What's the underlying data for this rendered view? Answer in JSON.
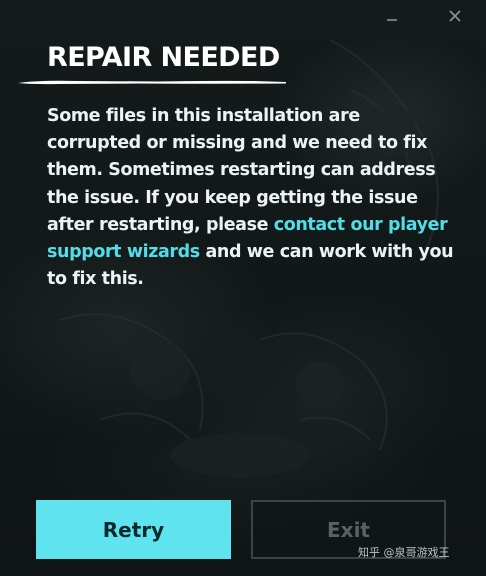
{
  "dialog": {
    "title": "REPAIR NEEDED",
    "body_text_1": "Some files in this installation are corrupted or missing and we need to fix them. Sometimes restarting can address the issue. If you keep getting the issue after restarting, please ",
    "body_link": "contact our player support wizards",
    "body_text_2": " and we can work with you to fix this."
  },
  "window_controls": {
    "minimize_icon": "minimize-icon",
    "close_icon": "close-icon"
  },
  "buttons": {
    "retry_label": "Retry",
    "exit_label": "Exit",
    "exit_enabled": false
  },
  "watermark": {
    "text": "知乎 @泉哥游戏王"
  },
  "colors": {
    "accent": "#5ee3ef",
    "link": "#53dde9",
    "text": "#eef2f2",
    "background": "#121818",
    "disabled": "#5a6262"
  }
}
